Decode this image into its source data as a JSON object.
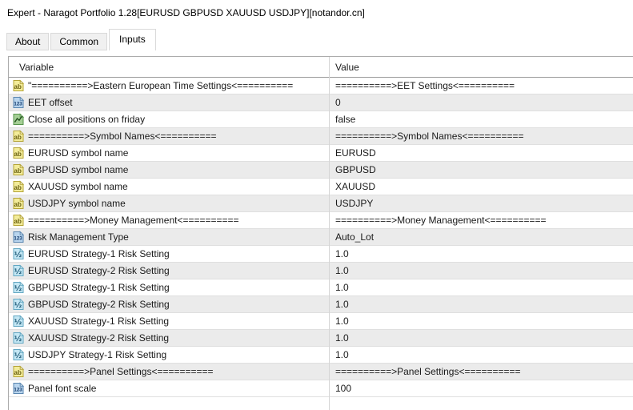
{
  "dialog": {
    "title": "Expert - Naragot Portfolio 1.28[EURUSD GBPUSD XAUUSD USDJPY][notandor.cn]"
  },
  "tabs": [
    {
      "label": "About",
      "active": false
    },
    {
      "label": "Common",
      "active": false
    },
    {
      "label": "Inputs",
      "active": true
    }
  ],
  "icons": {
    "string": "ab-string-icon",
    "integer": "123-integer-icon",
    "boolean": "bool-chart-icon",
    "double": "half-fraction-double-icon"
  },
  "colors": {
    "row_alt": "#ebebeb",
    "grid_line": "#dfdfdf",
    "header_separator": "#9b9b9b",
    "string_icon_fill": "#f3ec9a",
    "integer_icon_fill": "#b9d5ee",
    "boolean_icon_fill": "#a5cf96",
    "double_icon_fill": "#c4e7f4"
  },
  "table": {
    "columns": [
      "Variable",
      "Value"
    ],
    "rows": [
      {
        "type": "string",
        "variable": "\"==========>Eastern European Time Settings<==========",
        "value": "==========>EET Settings<=========="
      },
      {
        "type": "integer",
        "variable": "EET offset",
        "value": "0"
      },
      {
        "type": "boolean",
        "variable": "Close all positions on friday",
        "value": "false"
      },
      {
        "type": "string",
        "variable": "==========>Symbol Names<==========",
        "value": "==========>Symbol Names<=========="
      },
      {
        "type": "string",
        "variable": "EURUSD symbol name",
        "value": "EURUSD"
      },
      {
        "type": "string",
        "variable": "GBPUSD symbol name",
        "value": "GBPUSD"
      },
      {
        "type": "string",
        "variable": "XAUUSD symbol name",
        "value": "XAUUSD"
      },
      {
        "type": "string",
        "variable": "USDJPY symbol name",
        "value": "USDJPY"
      },
      {
        "type": "string",
        "variable": "==========>Money Management<==========",
        "value": "==========>Money Management<=========="
      },
      {
        "type": "integer",
        "variable": "Risk Management Type",
        "value": "Auto_Lot"
      },
      {
        "type": "double",
        "variable": "EURUSD Strategy-1 Risk Setting",
        "value": "1.0"
      },
      {
        "type": "double",
        "variable": "EURUSD Strategy-2 Risk Setting",
        "value": "1.0"
      },
      {
        "type": "double",
        "variable": "GBPUSD Strategy-1 Risk Setting",
        "value": "1.0"
      },
      {
        "type": "double",
        "variable": "GBPUSD Strategy-2 Risk Setting",
        "value": "1.0"
      },
      {
        "type": "double",
        "variable": "XAUUSD Strategy-1 Risk Setting",
        "value": "1.0"
      },
      {
        "type": "double",
        "variable": "XAUUSD Strategy-2 Risk Setting",
        "value": "1.0"
      },
      {
        "type": "double",
        "variable": "USDJPY Strategy-1 Risk Setting",
        "value": "1.0"
      },
      {
        "type": "string",
        "variable": "==========>Panel Settings<==========",
        "value": "==========>Panel Settings<=========="
      },
      {
        "type": "integer",
        "variable": "Panel font scale",
        "value": "100"
      }
    ]
  }
}
